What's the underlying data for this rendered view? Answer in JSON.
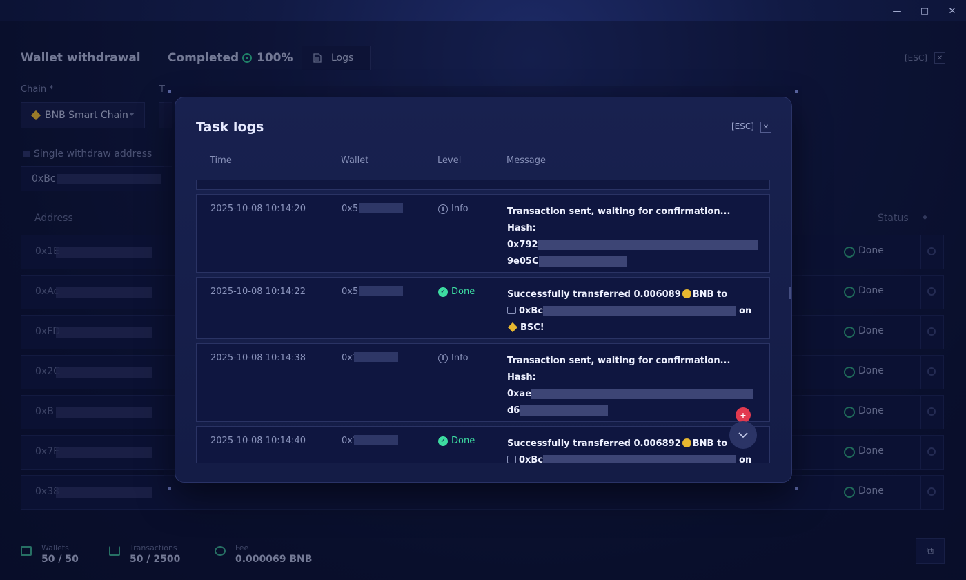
{
  "window": {
    "minimize_icon": "—",
    "maximize_icon": "□",
    "close_icon": "✕"
  },
  "header": {
    "title": "Wallet withdrawal",
    "status": "Completed",
    "percent": "100%",
    "logs_label": "Logs",
    "esc_label": "[ESC]"
  },
  "form": {
    "chain_label": "Chain *",
    "t_label": "T",
    "chain_value": "BNB Smart Chain",
    "single_label": "Single withdraw address",
    "address_value": "0xBc"
  },
  "table": {
    "address_header": "Address",
    "status_header": "Status",
    "rows": [
      {
        "address": "0x1E",
        "status": "Done"
      },
      {
        "address": "0xAc",
        "status": "Done"
      },
      {
        "address": "0xFD",
        "status": "Done"
      },
      {
        "address": "0x2C",
        "status": "Done"
      },
      {
        "address": "0xB",
        "status": "Done"
      },
      {
        "address": "0x7E",
        "status": "Done"
      },
      {
        "address": "0x38",
        "status": "Done"
      }
    ]
  },
  "footer": {
    "wallets_label": "Wallets",
    "wallets_value": "50 / 50",
    "transactions_label": "Transactions",
    "transactions_value": "50 / 2500",
    "fee_label": "Fee",
    "fee_value": "0.000069 BNB"
  },
  "modal": {
    "title": "Task logs",
    "esc_label": "[ESC]",
    "columns": {
      "time": "Time",
      "wallet": "Wallet",
      "level": "Level",
      "message": "Message"
    },
    "badge_count": "+",
    "entries": [
      {
        "time": "2025-10-08 10:14:20",
        "wallet": "0x5C",
        "level": "Info",
        "line1": "Transaction sent, waiting for confirmation...",
        "line2": "Hash:",
        "line3": "0x792",
        "line4": "9e05C"
      },
      {
        "time": "2025-10-08 10:14:22",
        "wallet": "0x5C",
        "level": "Done",
        "line1_a": "Successfully transferred 0.006089",
        "line1_b": "BNB to",
        "line2": "0xBc",
        "line2_b": "on",
        "line3": "BSC!"
      },
      {
        "time": "2025-10-08 10:14:38",
        "wallet": "0x1",
        "level": "Info",
        "line1": "Transaction sent, waiting for confirmation...",
        "line2": "Hash:",
        "line3": "0xae",
        "line4": "d6"
      },
      {
        "time": "2025-10-08 10:14:40",
        "wallet": "0x1",
        "level": "Done",
        "line1_a": "Successfully transferred 0.006892",
        "line1_b": "BNB to",
        "line2": "0xBc",
        "line2_b": "on"
      }
    ]
  },
  "colors": {
    "accent_done": "#3ddca1",
    "badge_red": "#e23a4f",
    "bnb_gold": "#e8b830"
  }
}
